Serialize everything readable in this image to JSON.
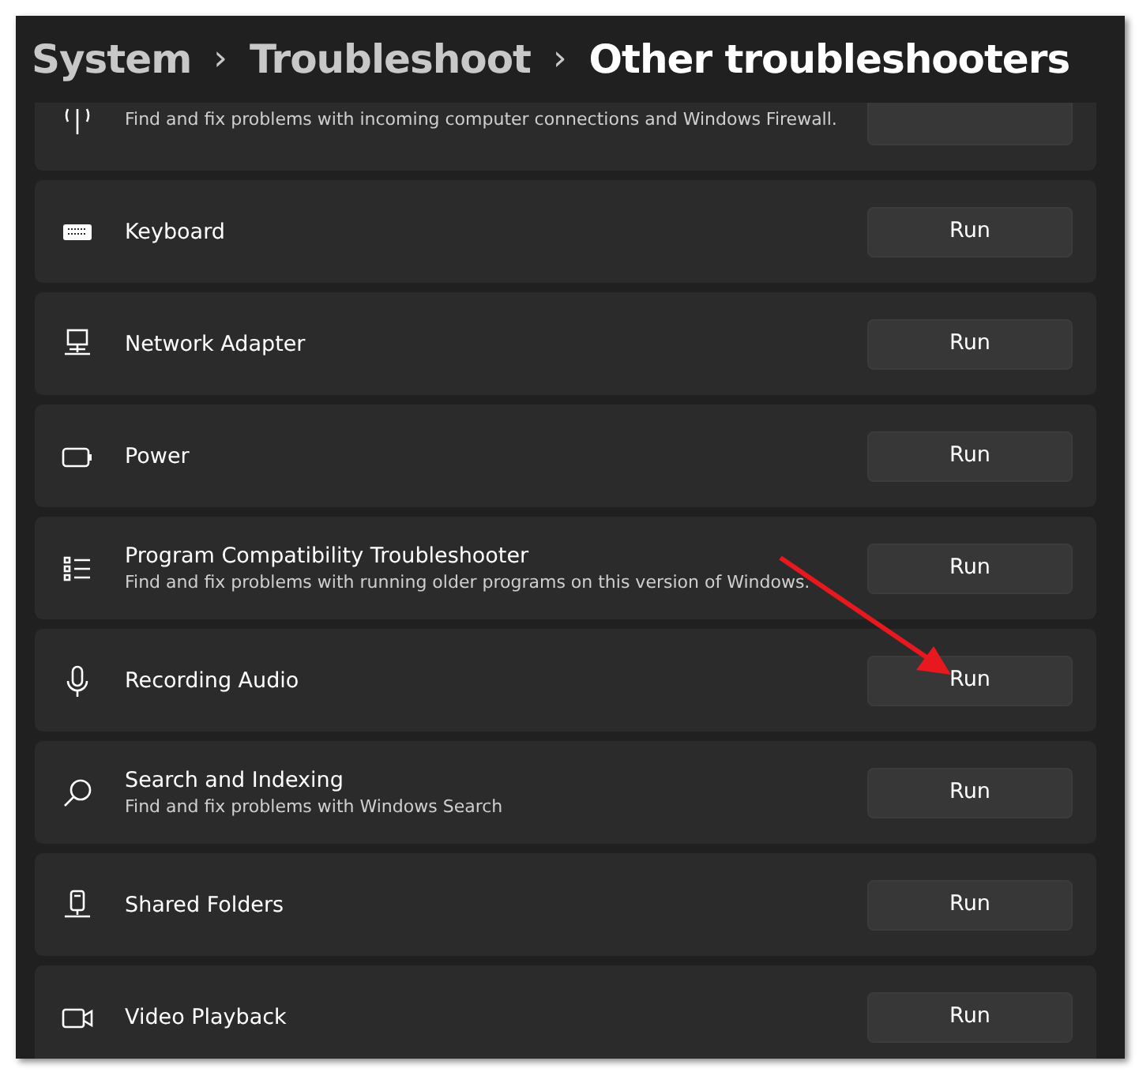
{
  "breadcrumb": [
    {
      "label": "System",
      "current": false
    },
    {
      "label": "Troubleshoot",
      "current": false
    },
    {
      "label": "Other troubleshooters",
      "current": true
    }
  ],
  "separator": "›",
  "troubleshooters": [
    {
      "description": "Find and fix problems with incoming computer connections and Windows Firewall."
    },
    {
      "title": "Keyboard",
      "button": "Run"
    },
    {
      "title": "Network Adapter",
      "button": "Run"
    },
    {
      "title": "Power",
      "button": "Run"
    },
    {
      "title": "Program Compatibility Troubleshooter",
      "description": "Find and fix problems with running older programs on this version of Windows.",
      "button": "Run"
    },
    {
      "title": "Recording Audio",
      "button": "Run"
    },
    {
      "title": "Search and Indexing",
      "description": "Find and fix problems with Windows Search",
      "button": "Run"
    },
    {
      "title": "Shared Folders",
      "button": "Run"
    },
    {
      "title": "Video Playback",
      "button": "Run"
    }
  ],
  "annotation": {
    "kind": "arrow",
    "color": "#e8191e"
  }
}
